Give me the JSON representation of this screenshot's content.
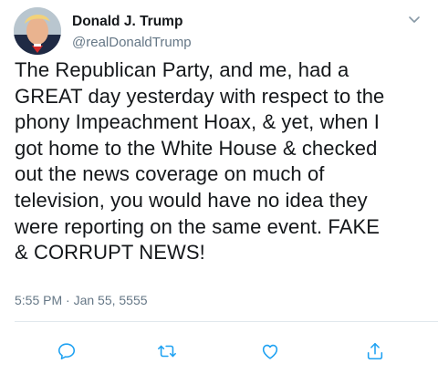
{
  "author": {
    "display_name": "Donald J. Trump",
    "handle": "@realDonaldTrump",
    "avatar_icon": "profile-photo"
  },
  "tweet": {
    "text": "The Republican Party, and me, had a\nGREAT day yesterday with respect to the\nphony Impeachment Hoax, & yet, when I\ngot home to the White House & checked\nout the news coverage on much of\ntelevision, you would have no idea they\nwere reporting on the same event. FAKE\n& CORRUPT NEWS!",
    "timestamp": "5:55 PM · Jan 55, 5555"
  },
  "menu": {
    "icon": "chevron-down-icon"
  },
  "actions": [
    {
      "name": "reply",
      "icon": "reply-icon"
    },
    {
      "name": "retweet",
      "icon": "retweet-icon"
    },
    {
      "name": "like",
      "icon": "like-icon"
    },
    {
      "name": "share",
      "icon": "share-icon"
    }
  ],
  "colors": {
    "text": "#14171a",
    "secondary": "#657786",
    "icon": "#1da1f2",
    "divider": "#e1e8ed"
  }
}
